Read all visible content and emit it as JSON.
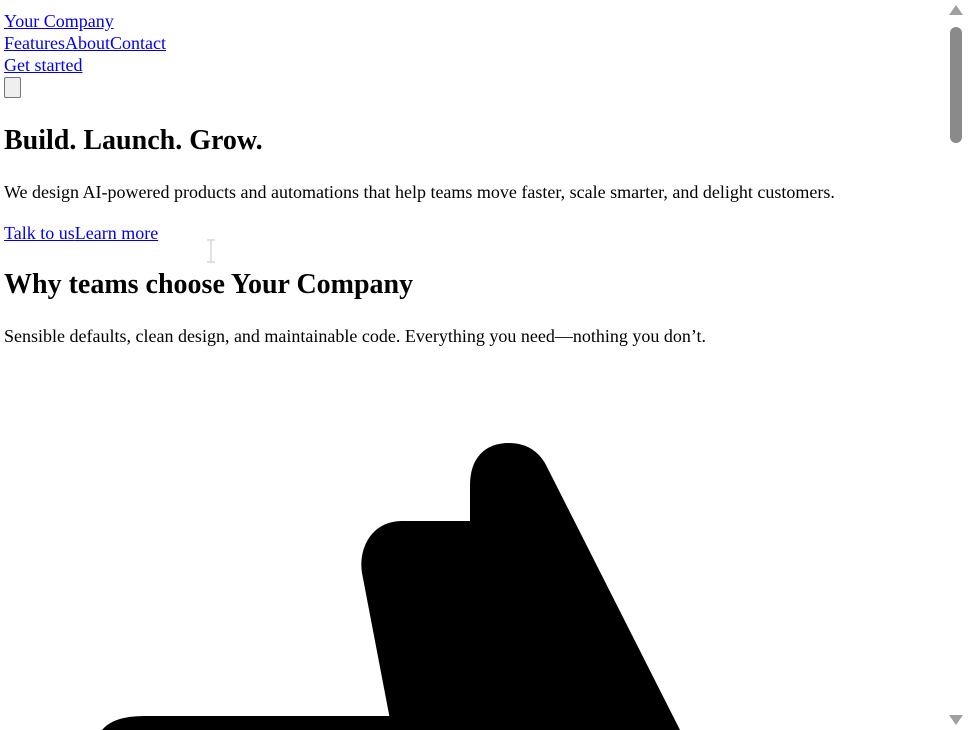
{
  "header": {
    "brand": "Your Company",
    "nav": [
      "Features",
      "About",
      "Contact"
    ],
    "cta": "Get started"
  },
  "hero": {
    "title": "Build. Launch. Grow.",
    "lead": "We design AI-powered products and automations that help teams move faster, scale smarter, and delight customers.",
    "primary_link": "Talk to us",
    "secondary_link": "Learn more"
  },
  "features": {
    "title": "Why teams choose Your Company",
    "subtitle": "Sensible defaults, clean design, and maintainable code. Everything you need—nothing you don’t."
  },
  "colors": {
    "link": "#0000ee",
    "text": "#000000",
    "scroll_thumb": "#8a8a8a"
  },
  "icons": {
    "illustration": "thumbs-up-icon",
    "menu": "menu-icon",
    "cursor": "text-cursor-icon"
  },
  "scroll": {
    "position": 0
  }
}
